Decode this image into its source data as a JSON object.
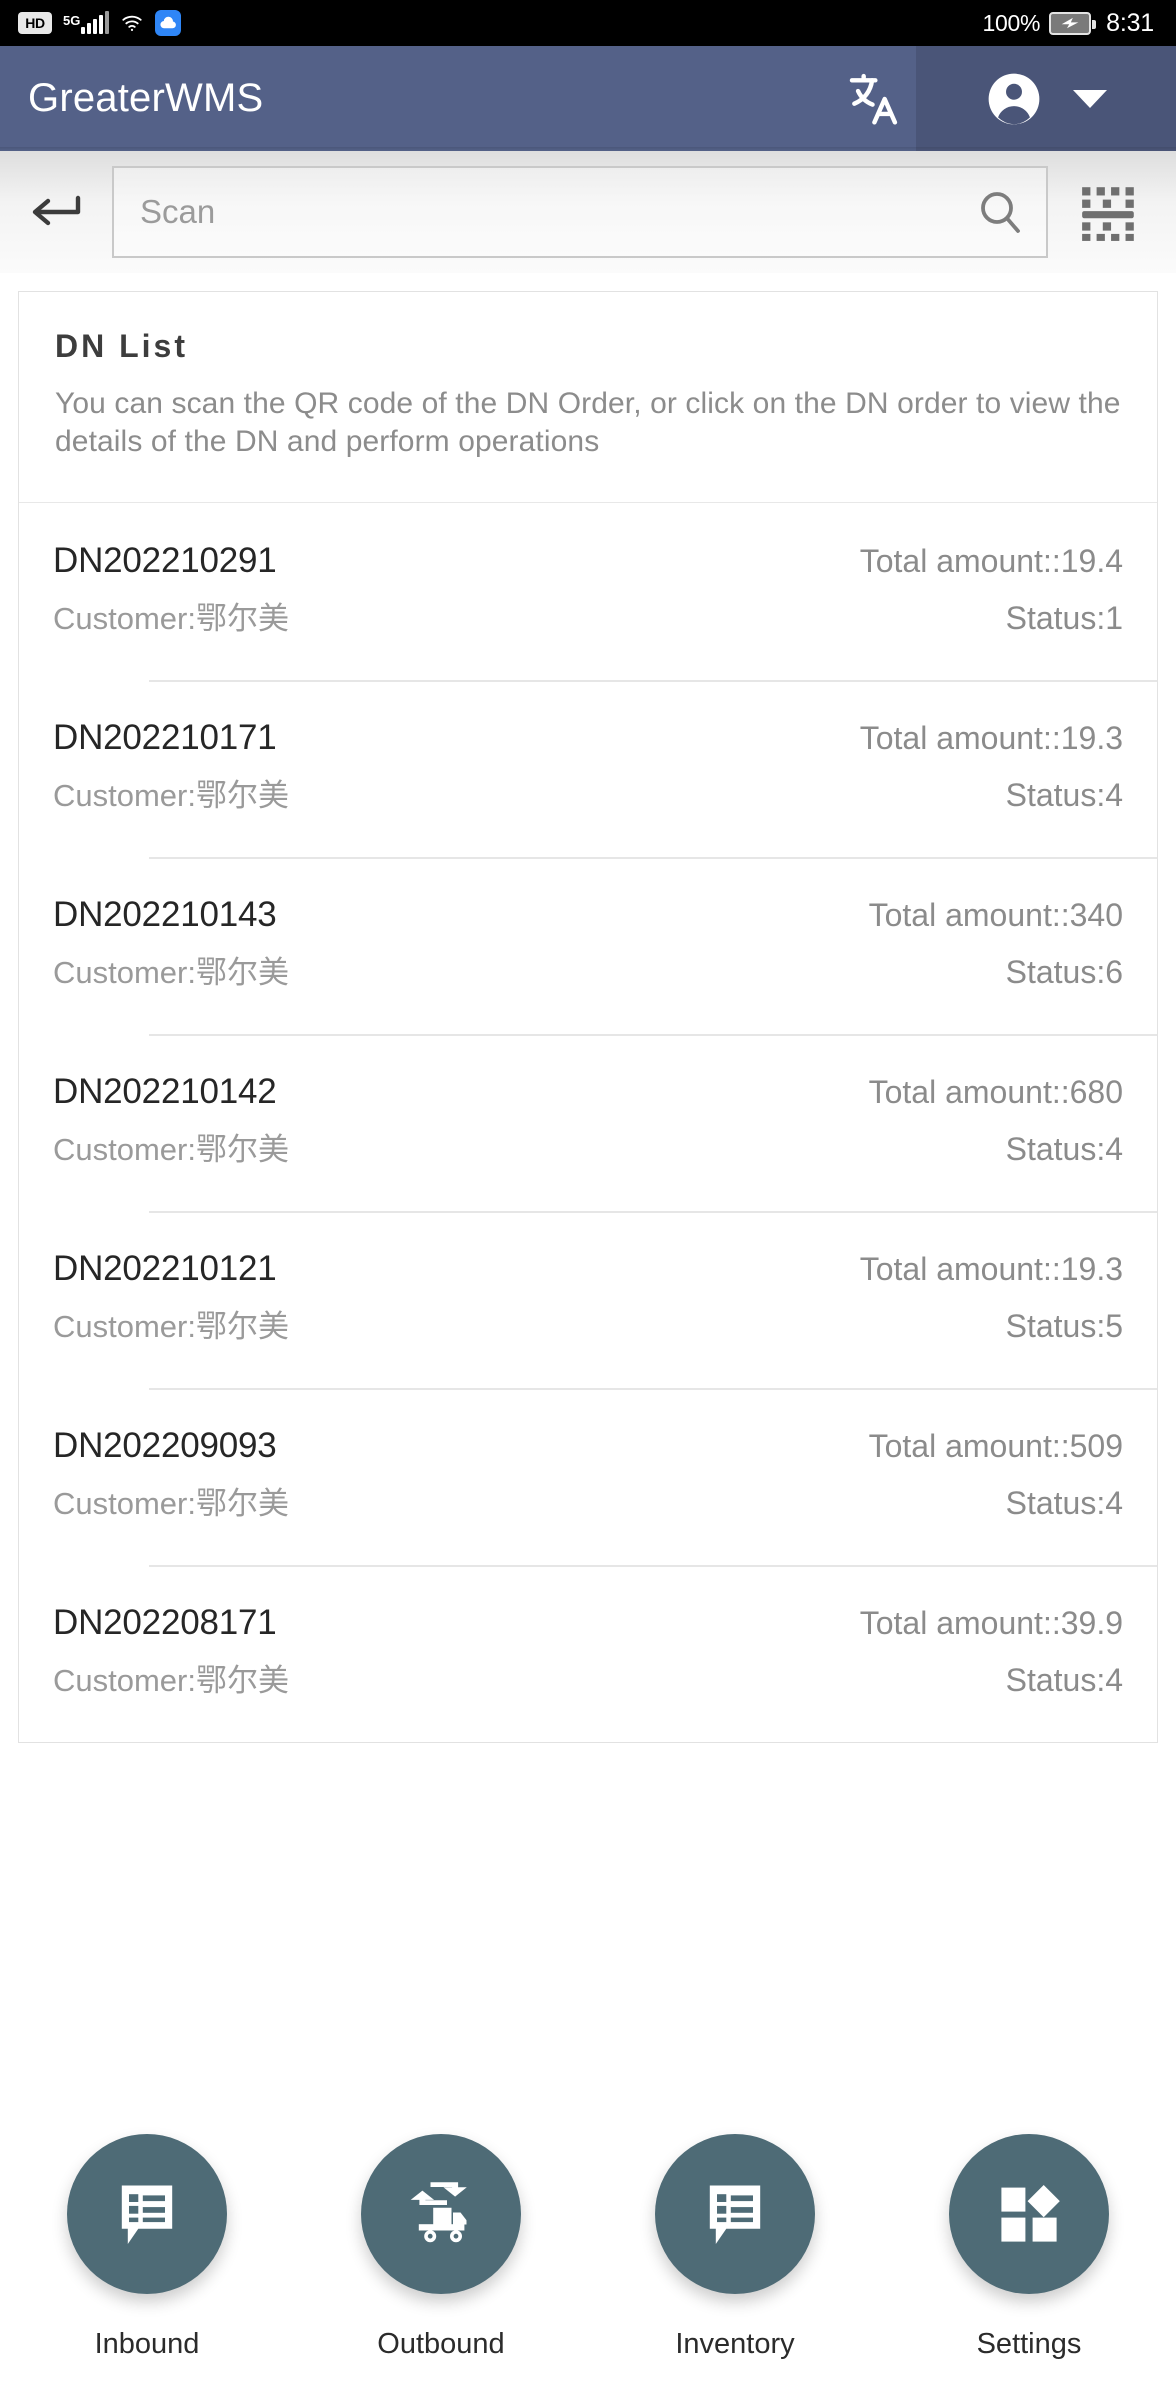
{
  "status_bar": {
    "hd_label": "HD",
    "network_label": "5G",
    "icons": [
      "hd-badge-icon",
      "signal-bars-icon",
      "wifi-icon",
      "cloud-icon"
    ],
    "battery_percent": "100%",
    "battery_icon": "battery-charging-icon",
    "time": "8:31"
  },
  "header": {
    "title": "GreaterWMS",
    "language_icon": "translate-icon",
    "account_icon": "account-circle-icon",
    "dropdown_icon": "chevron-down-icon"
  },
  "search": {
    "back_icon": "back-arrow-icon",
    "placeholder": "Scan",
    "value": "",
    "search_icon": "search-icon",
    "scan_icon": "qr-scan-icon"
  },
  "card": {
    "title": "DN List",
    "description": "You can scan the QR code of the DN Order, or click on the DN order to view the details of the DN and perform operations"
  },
  "list": {
    "amount_prefix": "Total amount::",
    "customer_prefix": "Customer:",
    "status_prefix": "Status:",
    "items": [
      {
        "code": "DN202210291",
        "amount": "Total amount::19.4",
        "customer": "Customer:鄂尔美",
        "status": "Status:1"
      },
      {
        "code": "DN202210171",
        "amount": "Total amount::19.3",
        "customer": "Customer:鄂尔美",
        "status": "Status:4"
      },
      {
        "code": "DN202210143",
        "amount": "Total amount::340",
        "customer": "Customer:鄂尔美",
        "status": "Status:6"
      },
      {
        "code": "DN202210142",
        "amount": "Total amount::680",
        "customer": "Customer:鄂尔美",
        "status": "Status:4"
      },
      {
        "code": "DN202210121",
        "amount": "Total amount::19.3",
        "customer": "Customer:鄂尔美",
        "status": "Status:5"
      },
      {
        "code": "DN202209093",
        "amount": "Total amount::509",
        "customer": "Customer:鄂尔美",
        "status": "Status:4"
      },
      {
        "code": "DN202208171",
        "amount": "Total amount::39.9",
        "customer": "Customer:鄂尔美",
        "status": "Status:4"
      }
    ]
  },
  "bottom_nav": {
    "items": [
      {
        "label": "Inbound",
        "icon": "list-bubble-icon"
      },
      {
        "label": "Outbound",
        "icon": "transfer-truck-icon"
      },
      {
        "label": "Inventory",
        "icon": "list-bubble-icon"
      },
      {
        "label": "Settings",
        "icon": "apps-grid-icon"
      }
    ]
  },
  "colors": {
    "header_bg": "#546188",
    "header_account_bg": "#4a5578",
    "nav_circle": "#4e6b76",
    "status_bar_bg": "#000000",
    "cloud_icon": "#2f86f6"
  }
}
